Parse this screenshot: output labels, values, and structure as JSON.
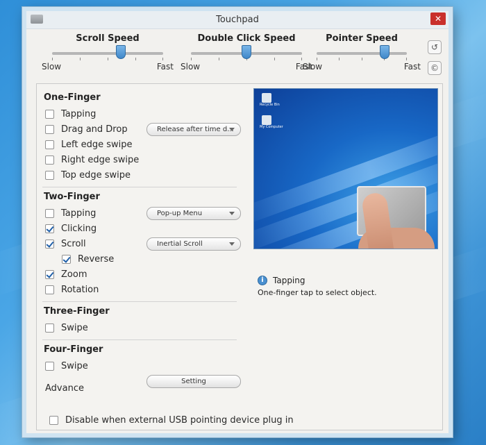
{
  "window": {
    "title": "Touchpad"
  },
  "sliders": [
    {
      "title": "Scroll Speed",
      "min_label": "Slow",
      "max_label": "Fast",
      "value": 0.62
    },
    {
      "title": "Double Click Speed",
      "min_label": "Slow",
      "max_label": "Fast",
      "value": 0.5
    },
    {
      "title": "Pointer Speed",
      "min_label": "Slow",
      "max_label": "Fast",
      "value": 0.75
    }
  ],
  "side_buttons": {
    "restore_icon": "restore-icon",
    "copyright_icon": "copyright-icon",
    "copyright_glyph": "©"
  },
  "one_finger": {
    "title": "One-Finger",
    "tapping": "Tapping",
    "drag_and_drop": "Drag and Drop",
    "drag_dropdown": "Release after time d...",
    "left_edge_swipe": "Left edge swipe",
    "right_edge_swipe": "Right edge swipe",
    "top_edge_swipe": "Top edge swipe"
  },
  "two_finger": {
    "title": "Two-Finger",
    "tapping": "Tapping",
    "tapping_dropdown": "Pop-up Menu",
    "clicking": "Clicking",
    "scroll": "Scroll",
    "scroll_dropdown": "Inertial Scroll",
    "reverse": "Reverse",
    "zoom": "Zoom",
    "rotation": "Rotation"
  },
  "three_finger": {
    "title": "Three-Finger",
    "swipe": "Swipe"
  },
  "four_finger": {
    "title": "Four-Finger",
    "swipe": "Swipe"
  },
  "advance": {
    "label": "Advance",
    "button": "Setting"
  },
  "disable_usb": "Disable when external USB pointing device plug in",
  "preview": {
    "icons": [
      {
        "label": "Recycle Bin"
      },
      {
        "label": "My Computer"
      }
    ]
  },
  "info": {
    "icon_glyph": "i",
    "title": "Tapping",
    "description": "One-finger tap to select object."
  },
  "checked": {
    "two_clicking": true,
    "two_scroll": true,
    "two_reverse": true,
    "two_zoom": true
  },
  "colors": {
    "accent": "#3f87c9",
    "close": "#c9302c"
  }
}
